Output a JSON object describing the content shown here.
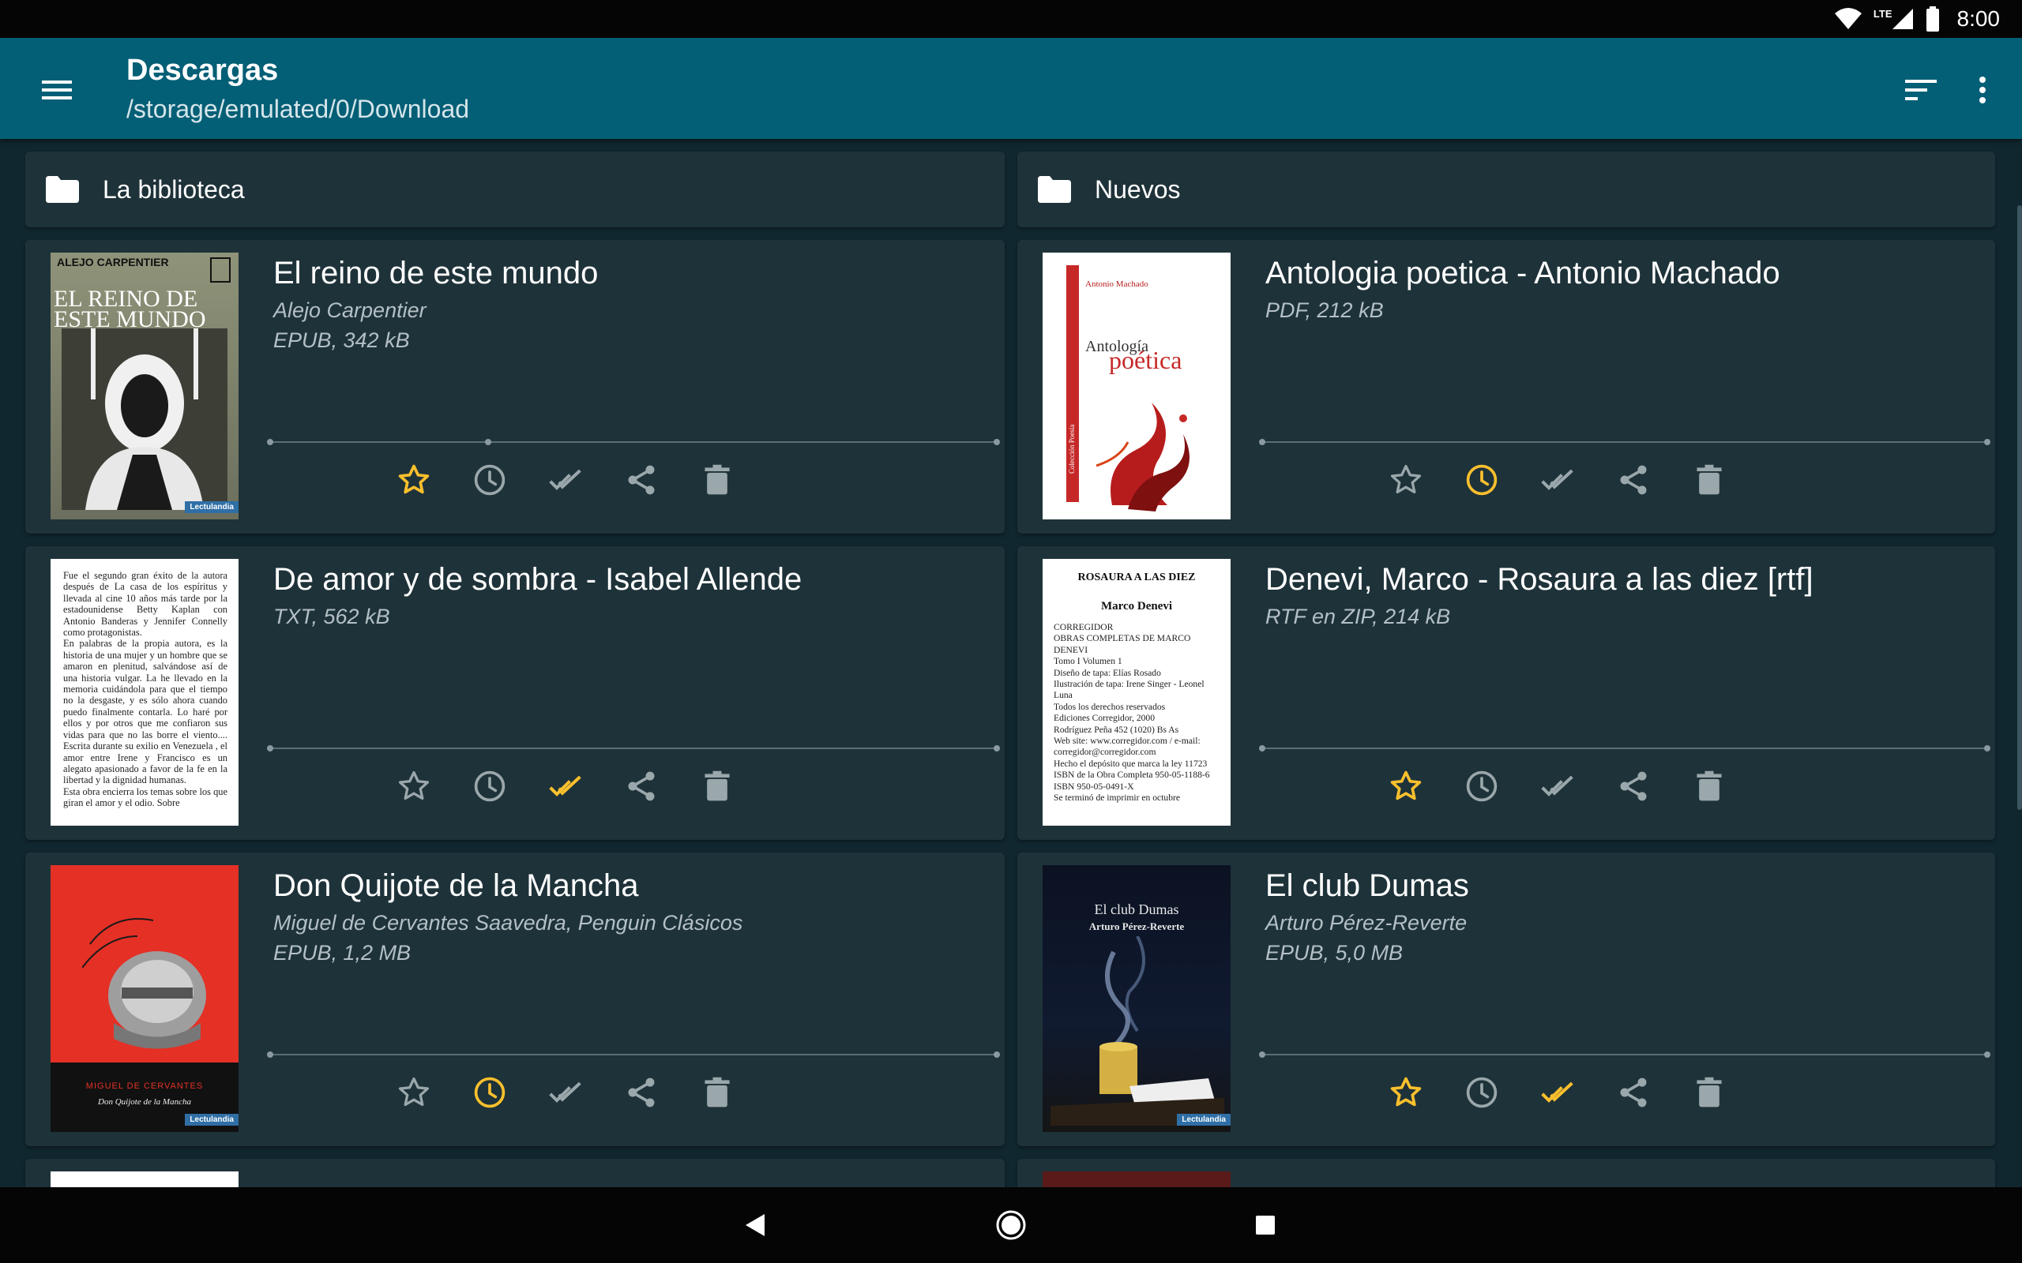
{
  "status_bar": {
    "time": "8:00",
    "network": "LTE"
  },
  "toolbar": {
    "title": "Descargas",
    "path": "/storage/emulated/0/Download"
  },
  "folders": [
    {
      "name": "La biblioteca"
    },
    {
      "name": "Nuevos"
    }
  ],
  "colors": {
    "accent": "#fbc02d",
    "icon_inactive": "#9aa7ab",
    "appbar": "#035f76",
    "card": "#1e3239",
    "background": "#10272f"
  },
  "books": [
    {
      "title": "El reino de este mundo",
      "author": "Alejo Carpentier",
      "format": "EPUB, 342 kB",
      "progress": 0.3,
      "favorite": true,
      "to_read": false,
      "finished": false,
      "cover": {
        "author": "ALEJO CARPENTIER",
        "title_line1": "EL REINO DE",
        "title_line2": "ESTE MUNDO",
        "publisher": "Lectulandia"
      }
    },
    {
      "title": "Antologia poetica - Antonio Machado",
      "author": "",
      "format": "PDF, 212 kB",
      "progress": 0,
      "favorite": false,
      "to_read": true,
      "finished": false,
      "cover": {
        "author": "Antonio Machado",
        "title_line1": "Antología",
        "title_line2": "poética",
        "spine": "Colección Poesía"
      }
    },
    {
      "title": "De amor y de sombra - Isabel Allende",
      "author": "",
      "format": "TXT, 562 kB",
      "progress": 0,
      "favorite": false,
      "to_read": false,
      "finished": true,
      "cover": {
        "text": "Fue el segundo gran éxito de la autora después de La casa de los espíritus y llevada al cine 10 años más tarde por la estadounidense Betty Kaplan con Antonio Banderas y Jennifer Connelly como protagonistas.\n   En palabras de la propia autora, es la historia de una mujer y un hombre que se amaron en plenitud, salvándose así de una historia vulgar. La he llevado en la memoria cuidándola para que el tiempo no la desgaste, y es sólo ahora cuando puedo finalmente contarla. Lo haré por ellos y por otros que me confiaron sus vidas para que no las borre el viento.... Escrita durante su exilio en Venezuela , el amor entre Irene y Francisco es un alegato apasionado a favor de la fe en la libertad y la dignidad humanas.\n   Esta obra encierra los temas sobre los que giran el amor y el odio. Sobre"
      }
    },
    {
      "title": "Denevi, Marco - Rosaura a las diez [rtf]",
      "author": "",
      "format": "RTF en ZIP, 214 kB",
      "progress": 0,
      "favorite": true,
      "to_read": false,
      "finished": false,
      "cover": {
        "title": "ROSAURA A LAS DIEZ",
        "author": "Marco Denevi",
        "text": "   CORREGIDOR\n   OBRAS COMPLETAS DE MARCO DENEVI\n   Tomo I Volumen 1\n   Diseño de tapa: Elías Rosado\n   Ilustración de tapa: Irene Singer - Leonel Luna\n   Todos los derechos reservados\n   Ediciones Corregidor, 2000\n   Rodríguez Peña 452 (1020) Bs As\n   Web site: www.corregidor.com / e-mail: corregidor@corregidor.com\n   Hecho el depósito que marca la ley 11723\n   ISBN de la Obra Completa 950-05-1188-6\n   ISBN 950-05-0491-X\n   Se terminó de imprimir en octubre"
      }
    },
    {
      "title": "Don Quijote de la Mancha",
      "author": "Miguel de Cervantes Saavedra, Penguin Clásicos",
      "format": "EPUB, 1,2 MB",
      "progress": 0,
      "favorite": false,
      "to_read": true,
      "finished": false,
      "cover": {
        "author": "MIGUEL DE CERVANTES",
        "title": "Don Quijote de la Mancha",
        "publisher": "Lectulandia"
      }
    },
    {
      "title": "El club Dumas",
      "author": "Arturo Pérez-Reverte",
      "format": "EPUB, 5,0 MB",
      "progress": 0,
      "favorite": true,
      "to_read": false,
      "finished": true,
      "cover": {
        "title": "El club Dumas",
        "author": "Arturo Pérez-Reverte",
        "publisher": "Lectulandia"
      }
    }
  ]
}
